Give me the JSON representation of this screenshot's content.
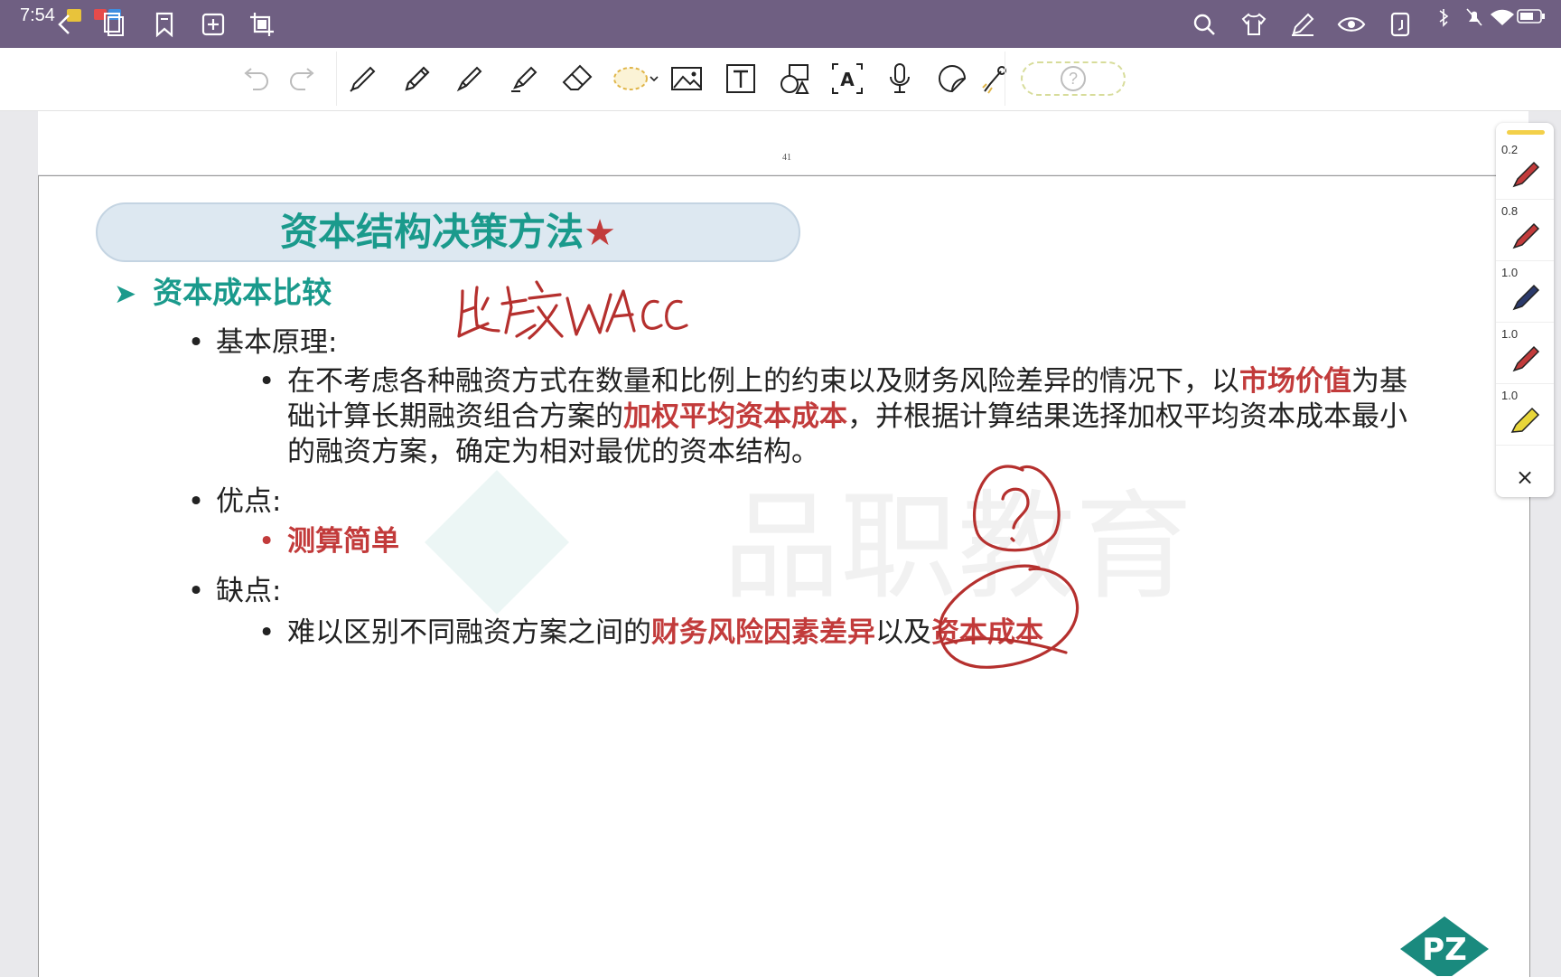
{
  "status_bar": {
    "time": "7:54"
  },
  "toolbar": {
    "tools": [
      "undo-icon",
      "redo-icon",
      "pen-icon",
      "pencil-icon",
      "fountain-pen-icon",
      "highlighter-icon",
      "eraser-icon",
      "lasso-icon",
      "image-icon",
      "text-box-icon",
      "shape-icon",
      "ocr-text-icon",
      "microphone-icon",
      "sticker-icon",
      "laser-pointer-icon",
      "help-icon"
    ]
  },
  "page": {
    "number": "41"
  },
  "slide": {
    "title": "资本结构决策方法",
    "title_star": "★",
    "section_heading": "资本成本比较",
    "principle_label": "基本原理:",
    "principle_text": {
      "line1_a": "在不考虑各种融资方式在数量和比例上的约束以及财务风险差异的情况下，以",
      "line1_b": "市场价值",
      "line1_c": "为基",
      "line2_a": "础计算长期融资组合方案的",
      "line2_b": "加权平均资本成本",
      "line2_c": "，并根据计算结果选择加权平均资本成本最小",
      "line3": "的融资方案，确定为相对最优的资本结构。"
    },
    "advantages_label": "优点:",
    "advantage_item": "测算简单",
    "disadvantages_label": "缺点:",
    "disadvantage_item": {
      "a": "难以区别不同融资方案之间的",
      "b": "财务风险因素差异",
      "c": "以及",
      "d": "资本成本"
    },
    "watermark_text": "品职教育",
    "logo_text": "PZ"
  },
  "pen_panel": {
    "pens": [
      {
        "width": "0.2",
        "color": "#c23b3b"
      },
      {
        "width": "0.8",
        "color": "#c23b3b"
      },
      {
        "width": "1.0",
        "color": "#2b3a6b"
      },
      {
        "width": "1.0",
        "color": "#c23b3b"
      },
      {
        "width": "1.0",
        "color": "#e8d63a"
      }
    ],
    "close": "×"
  },
  "annotations": {
    "handwritten_note": "比较WACC",
    "ink_color": "#b5302e"
  }
}
